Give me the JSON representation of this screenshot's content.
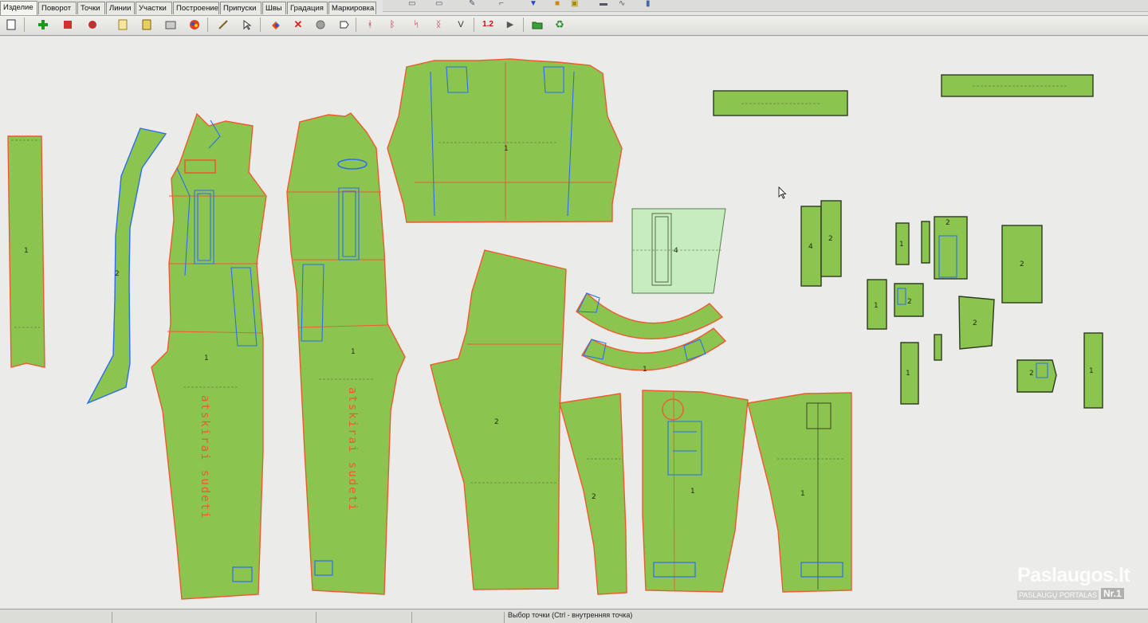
{
  "tabs": [
    {
      "label": "Изделие",
      "active": true
    },
    {
      "label": "Поворот",
      "active": false
    },
    {
      "label": "Точки",
      "active": false
    },
    {
      "label": "Линии",
      "active": false
    },
    {
      "label": "Участки",
      "active": false
    },
    {
      "label": "Построение",
      "active": false
    },
    {
      "label": "Припуски",
      "active": false
    },
    {
      "label": "Швы",
      "active": false
    },
    {
      "label": "Градация",
      "active": false
    },
    {
      "label": "Маркировка",
      "active": false
    }
  ],
  "toolbar": {
    "scale_label": "1.2",
    "icons": [
      "new-file-icon",
      "add-piece-icon",
      "delete-piece-icon",
      "bug-icon",
      "page-icon",
      "page-yellow-icon",
      "layers-icon",
      "palette-icon",
      "pencil-icon",
      "select-arrow-icon",
      "color-fill-icon",
      "delete-x-icon",
      "circle-icon",
      "tag-icon",
      "mirror-icon",
      "mirror-n-icon",
      "mirror-s-icon",
      "mirror-curve-icon",
      "v-icon",
      "scale-icon",
      "play-icon",
      "folder-icon",
      "recycle-icon"
    ]
  },
  "pieces": {
    "strip_left_label": "1",
    "facing_label": "2",
    "front_left_label": "1",
    "front_left_text": "atskirai sudeti",
    "front_right_label": "1",
    "front_right_text": "atskirai sudeti",
    "back_top_label": "1",
    "pocket_label": "4",
    "back_leg_label": "2",
    "sleeve_label": "2",
    "leg_front_label": "1",
    "leg_back_label": "1",
    "collar_label": "1",
    "small_4_label": "4",
    "small_2_label": "2",
    "tab_1_label": "1",
    "tab_2_label": "2",
    "big_2_label": "2",
    "mid_2_label": "2",
    "small_1_label": "1",
    "piece_2_label": "2",
    "strap_1_label": "1",
    "right_2_label": "2",
    "right_1_label": "1"
  },
  "status": {
    "text": "Выбор точки (Ctrl - внутренняя точка)"
  },
  "watermark": {
    "title": "Paslaugos.lt",
    "subtitle": "PASLAUGŲ PORTALAS",
    "badge": "Nr.1"
  },
  "colors": {
    "piece_fill": "#8cc450",
    "piece_fill_light": "#c7ecc0",
    "outline": "#ee5a2e",
    "construction": "#2a6ef0",
    "canvas": "#ebebea"
  }
}
